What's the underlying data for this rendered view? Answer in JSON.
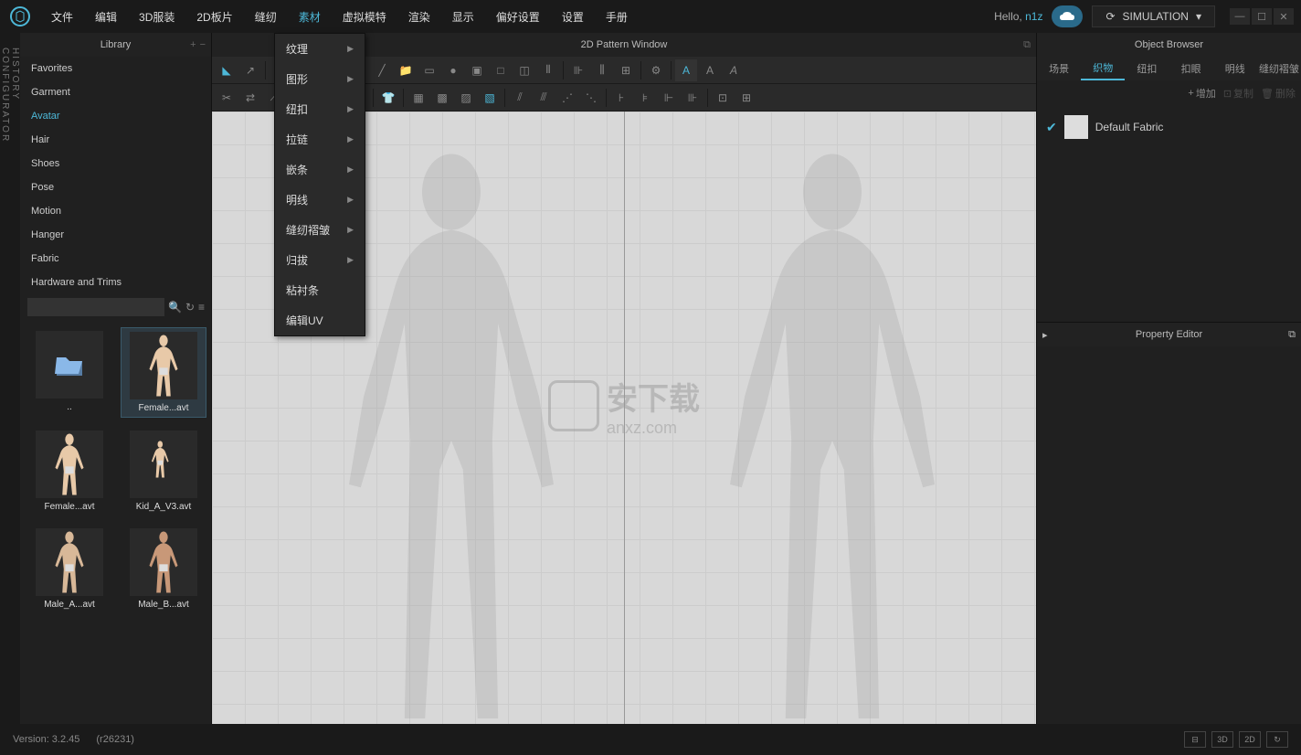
{
  "menubar": {
    "items": [
      "文件",
      "编辑",
      "3D服装",
      "2D板片",
      "缝纫",
      "素材",
      "虚拟模特",
      "渲染",
      "显示",
      "偏好设置",
      "设置",
      "手册"
    ],
    "active_index": 5,
    "hello_prefix": "Hello, ",
    "username": "n1z",
    "mode": "SIMULATION"
  },
  "dropdown": {
    "items": [
      {
        "label": "纹理",
        "submenu": true
      },
      {
        "label": "图形",
        "submenu": true
      },
      {
        "label": "纽扣",
        "submenu": true
      },
      {
        "label": "拉链",
        "submenu": true
      },
      {
        "label": "嵌条",
        "submenu": true
      },
      {
        "label": "明线",
        "submenu": true
      },
      {
        "label": "缝纫褶皱",
        "submenu": true
      },
      {
        "label": "归拔",
        "submenu": true
      },
      {
        "label": "粘衬条",
        "submenu": false
      },
      {
        "label": "编辑UV",
        "submenu": false
      }
    ]
  },
  "side_tabs": [
    "HISTORY",
    "CONFIGURATOR"
  ],
  "library": {
    "title": "Library",
    "categories": [
      "Favorites",
      "Garment",
      "Avatar",
      "Hair",
      "Shoes",
      "Pose",
      "Motion",
      "Hanger",
      "Fabric",
      "Hardware and Trims"
    ],
    "active_category_index": 2,
    "items": [
      {
        "label": "..",
        "type": "folder",
        "selected": false
      },
      {
        "label": "Female...avt",
        "type": "avatar",
        "skin": "#e8c9a8",
        "selected": true
      },
      {
        "label": "Female...avt",
        "type": "avatar",
        "skin": "#e8c9a8",
        "selected": false
      },
      {
        "label": "Kid_A_V3.avt",
        "type": "avatar",
        "skin": "#e8c9a8",
        "selected": false,
        "small": true
      },
      {
        "label": "Male_A...avt",
        "type": "avatar",
        "skin": "#d8b898",
        "selected": false
      },
      {
        "label": "Male_B...avt",
        "type": "avatar",
        "skin": "#c89878",
        "selected": false
      }
    ]
  },
  "viewport": {
    "title": "2D Pattern Window",
    "watermark_text1": "安下载",
    "watermark_text2": "anxz.com"
  },
  "object_browser": {
    "title": "Object Browser",
    "tabs": [
      "场景",
      "织物",
      "纽扣",
      "扣眼",
      "明线",
      "缝纫褶皱"
    ],
    "active_tab_index": 1,
    "actions": {
      "add": "增加",
      "copy": "复制",
      "del": "删除"
    },
    "items": [
      {
        "name": "Default Fabric",
        "checked": true
      }
    ]
  },
  "property_editor": {
    "title": "Property Editor"
  },
  "statusbar": {
    "version_label": "Version: 3.2.45",
    "revision": "(r26231)",
    "view_buttons": [
      "3D",
      "2D"
    ]
  }
}
